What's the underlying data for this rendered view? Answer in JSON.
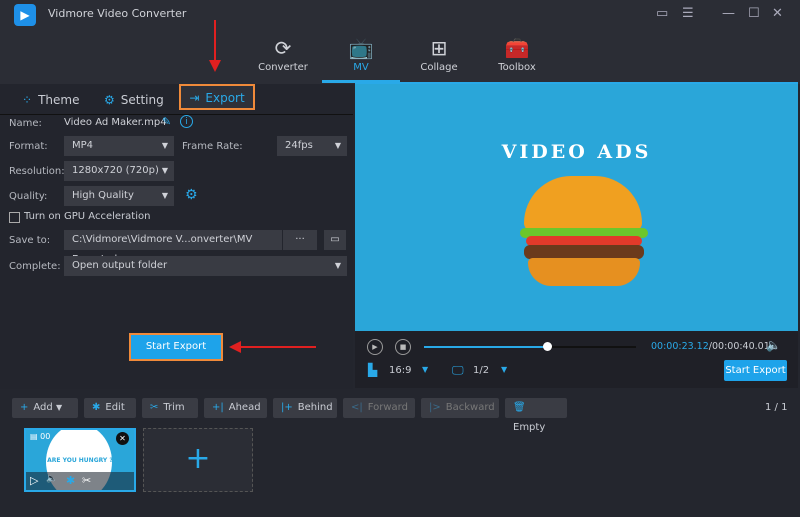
{
  "app": {
    "title": "Vidmore Video Converter"
  },
  "nav": {
    "tabs": [
      {
        "label": "Converter",
        "icon": "converter-icon"
      },
      {
        "label": "MV",
        "icon": "mv-tv-icon",
        "active": true
      },
      {
        "label": "Collage",
        "icon": "collage-icon"
      },
      {
        "label": "Toolbox",
        "icon": "toolbox-icon"
      }
    ]
  },
  "subtabs": [
    {
      "label": "Theme"
    },
    {
      "label": "Setting"
    },
    {
      "label": "Export",
      "active": true
    }
  ],
  "export": {
    "name_label": "Name:",
    "name_value": "Video Ad Maker.mp4",
    "format_label": "Format:",
    "format_value": "MP4",
    "framerate_label": "Frame Rate:",
    "framerate_value": "24fps",
    "resolution_label": "Resolution:",
    "resolution_value": "1280x720 (720p)",
    "quality_label": "Quality:",
    "quality_value": "High Quality",
    "gpu_label": "Turn on GPU Acceleration",
    "gpu_checked": false,
    "saveto_label": "Save to:",
    "saveto_value": "C:\\Vidmore\\Vidmore V...onverter\\MV Exported",
    "browse_label": "···",
    "complete_label": "Complete:",
    "complete_value": "Open output folder",
    "start_label": "Start Export"
  },
  "preview": {
    "title": "VIDEO ADS",
    "time_current": "00:00:23.12",
    "time_total": "/00:00:40.01",
    "progress": 0.578,
    "aspect": "16:9",
    "page": "1/2",
    "start_label": "Start Export"
  },
  "toolbar": {
    "add": "Add",
    "edit": "Edit",
    "trim": "Trim",
    "ahead": "Ahead",
    "behind": "Behind",
    "forward": "Forward",
    "backward": "Backward",
    "empty": "Empty",
    "page": "1 / 1"
  },
  "timeline": {
    "clip_text": "ARE YOU HUNGRY ?",
    "clip_time": "00"
  },
  "colors": {
    "accent": "#29a9e8",
    "highlight": "#f08a3a",
    "annotation": "#e02020",
    "preview_bg": "#2aa6d9"
  }
}
